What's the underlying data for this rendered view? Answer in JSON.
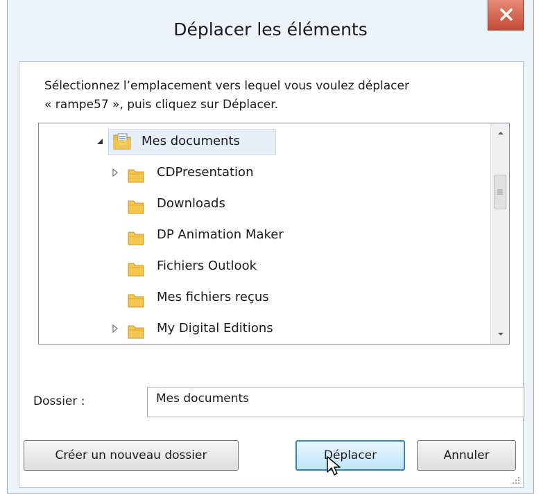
{
  "dialog": {
    "title": "Déplacer les éléments",
    "instruction_line1": "Sélectionnez l’emplacement vers lequel vous voulez déplacer",
    "instruction_line2": "« rampe57 », puis cliquez sur Déplacer."
  },
  "tree": {
    "root": {
      "label": "Mes documents",
      "expanded": true,
      "icon": "documents-folder-icon"
    },
    "items": [
      {
        "label": "CDPresentation",
        "has_children": true,
        "icon": "folder-icon"
      },
      {
        "label": "Downloads",
        "has_children": false,
        "icon": "folder-icon"
      },
      {
        "label": "DP Animation Maker",
        "has_children": false,
        "icon": "folder-icon"
      },
      {
        "label": "Fichiers Outlook",
        "has_children": false,
        "icon": "folder-icon"
      },
      {
        "label": "Mes fichiers reçus",
        "has_children": false,
        "icon": "folder-icon"
      },
      {
        "label": "My Digital Editions",
        "has_children": true,
        "icon": "folder-icon"
      }
    ]
  },
  "folder_field": {
    "label": "Dossier :",
    "value": "Mes documents"
  },
  "buttons": {
    "new_folder": "Créer un nouveau dossier",
    "move": "Déplacer",
    "cancel": "Annuler"
  },
  "colors": {
    "close_button": "#c44a36",
    "folder_yellow": "#f3c64f",
    "default_button_border": "#3c7fb1"
  }
}
